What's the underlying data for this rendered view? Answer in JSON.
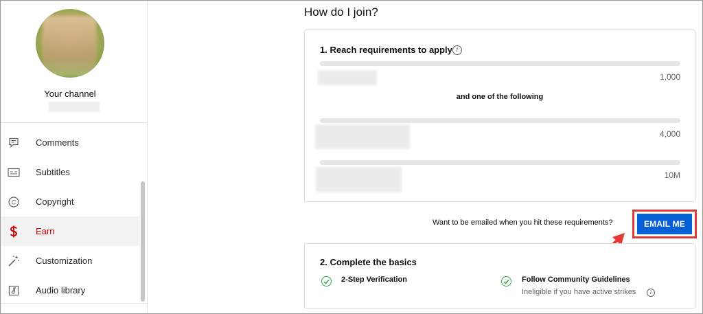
{
  "sidebar": {
    "channel_label": "Your channel",
    "items": [
      {
        "label": "Comments",
        "icon": "comment-icon",
        "active": false
      },
      {
        "label": "Subtitles",
        "icon": "subtitles-icon",
        "active": false
      },
      {
        "label": "Copyright",
        "icon": "copyright-icon",
        "active": false
      },
      {
        "label": "Earn",
        "icon": "dollar-icon",
        "active": true
      },
      {
        "label": "Customization",
        "icon": "magic-wand-icon",
        "active": false
      },
      {
        "label": "Audio library",
        "icon": "audio-library-icon",
        "active": false
      }
    ]
  },
  "main": {
    "heading": "How do I join?",
    "requirements": {
      "title": "1. Reach requirements to apply",
      "and_one": "and one of the following",
      "rows": [
        {
          "value": "1,000"
        },
        {
          "value": "4,000"
        },
        {
          "value": "10M"
        }
      ]
    },
    "email_prompt": "Want to be emailed when you hit these requirements?",
    "email_button": "EMAIL ME",
    "basics": {
      "title": "2. Complete the basics",
      "items": [
        {
          "label": "2-Step Verification",
          "sub": ""
        },
        {
          "label": "Follow Community Guidelines",
          "sub": "Ineligible if you have active strikes"
        }
      ]
    }
  },
  "colors": {
    "accent_red": "#cc0000",
    "button_blue": "#065fd4",
    "highlight_red": "#e53935",
    "check_green": "#2ba640"
  }
}
